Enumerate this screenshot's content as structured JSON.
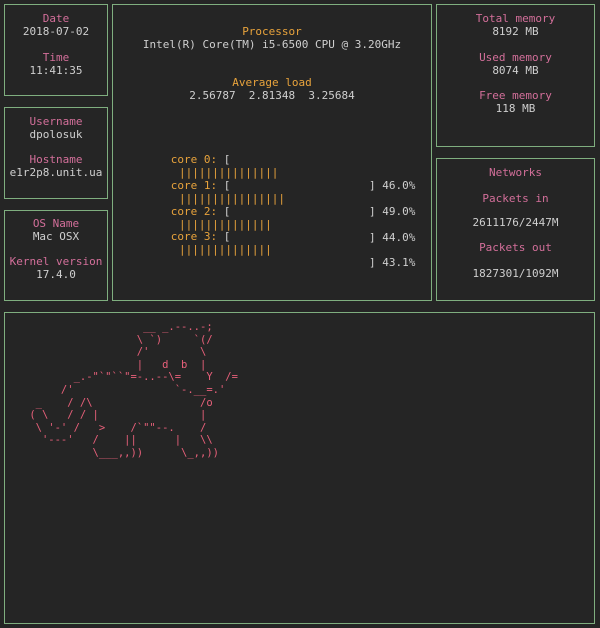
{
  "system": {
    "date_label": "Date",
    "date": "2018-07-02",
    "time_label": "Time",
    "time": "11:41:35",
    "username_label": "Username",
    "username": "dpolosuk",
    "hostname_label": "Hostname",
    "hostname": "e1r2p8.unit.ua",
    "os_name_label": "OS Name",
    "os_name": "Mac OSX",
    "kernel_label": "Kernel version",
    "kernel": "17.4.0"
  },
  "processor": {
    "label": "Processor",
    "model": "Intel(R) Core(TM) i5-6500 CPU @ 3.20GHz",
    "avg_load_label": "Average load",
    "avg_load": "2.56787  2.81348  3.25684",
    "cores": [
      {
        "label": "core 0:",
        "percent": "46.0%",
        "fraction": 0.46
      },
      {
        "label": "core 1:",
        "percent": "49.0%",
        "fraction": 0.49
      },
      {
        "label": "core 2:",
        "percent": "44.0%",
        "fraction": 0.44
      },
      {
        "label": "core 3:",
        "percent": "43.1%",
        "fraction": 0.431
      }
    ]
  },
  "memory": {
    "total_label": "Total memory",
    "total": "8192 MB",
    "used_label": "Used memory",
    "used": "8074 MB",
    "free_label": "Free memory",
    "free": "118 MB"
  },
  "network": {
    "title": "Networks",
    "packets_in_label": "Packets in",
    "packets_in": "2611176/2447M",
    "packets_out_label": "Packets out",
    "packets_out": "1827301/1092M"
  },
  "ascii_art": "                   __ _.--..-;\n                  \\ `)     `(/\n                  /'        \\\n                  |   d  b  |\n        _.-\"`\"``\"=-..--\\=    Y  /=\n      /'                `-.__=.'\n  _    / /\\                 /o\n ( \\   / / |                |\n  \\ '-' /   >    /`\"\"--.    /\n   '---'   /    ||      |   \\\\\n           \\___,,))      \\_,,))",
  "colors": {
    "background": "#252525",
    "border": "#7fae7f",
    "label": "#d36f9a",
    "accent": "#e8a33c",
    "ascii": "#e8607a"
  }
}
